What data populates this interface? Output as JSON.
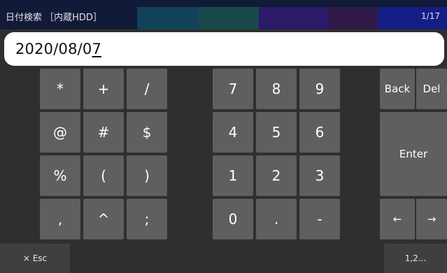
{
  "header": {
    "title": "日付検索 ［内蔵HDD］",
    "page_indicator": "1/17",
    "colors": {
      "band_teal": "#12415a",
      "band_green": "#17494a",
      "band_purple": "#2a1a68",
      "band_violet": "#2f1948"
    }
  },
  "input": {
    "value_prefix": "2020/08/0",
    "value_caret_char": "7"
  },
  "keys": {
    "symbols": [
      "*",
      "+",
      "/",
      "@",
      "#",
      "$",
      "%",
      "(",
      ")",
      ",",
      "^",
      ";"
    ],
    "digits": [
      "7",
      "8",
      "9",
      "4",
      "5",
      "6",
      "1",
      "2",
      "3",
      "0",
      ".",
      "-"
    ],
    "back": "Back",
    "del": "Del",
    "enter": "Enter",
    "left_arrow": "←",
    "right_arrow": "→"
  },
  "footer": {
    "esc_label": "× Esc",
    "alt_label": "1,2..."
  }
}
